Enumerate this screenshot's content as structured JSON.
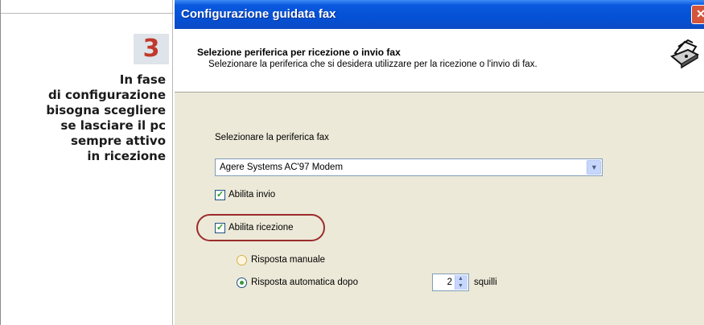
{
  "caption": {
    "step_number": "3",
    "lines": [
      "In fase",
      "di configurazione",
      "bisogna scegliere",
      "se lasciare il pc",
      "sempre attivo",
      "in ricezione"
    ]
  },
  "window": {
    "title": "Configurazione guidata fax",
    "close_glyph": "✕",
    "header": {
      "title": "Selezione periferica per ricezione o invio fax",
      "subtitle": "Selezionare la periferica che si desidera utilizzare per la ricezione o l'invio di fax.",
      "icon": "fax-machine-icon"
    },
    "form": {
      "device_label": "Selezionare la periferica fax",
      "device_value": "Agere Systems AC'97 Modem",
      "enable_send": {
        "label": "Abilita invio",
        "checked": true
      },
      "enable_receive": {
        "label": "Abilita ricezione",
        "checked": true
      },
      "manual_answer": {
        "label": "Risposta manuale",
        "selected": false
      },
      "auto_answer": {
        "label": "Risposta automatica dopo",
        "selected": true
      },
      "rings_value": "2",
      "rings_unit": "squilli"
    }
  },
  "colors": {
    "accent": "#c0392b",
    "highlight_ring": "#9b2b2b",
    "titlebar": "#0451d6"
  }
}
